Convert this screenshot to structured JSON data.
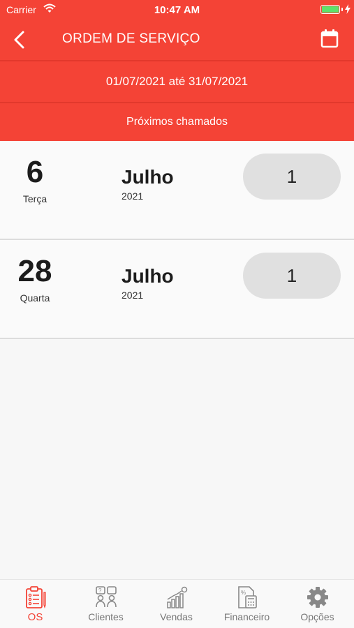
{
  "status_bar": {
    "carrier": "Carrier",
    "time": "10:47 AM"
  },
  "header": {
    "title": "ORDEM DE SERVIÇO"
  },
  "date_range": "01/07/2021 até 31/07/2021",
  "section_label": "Próximos chamados",
  "entries": [
    {
      "day": "6",
      "weekday": "Terça",
      "month": "Julho",
      "year": "2021",
      "count": "1"
    },
    {
      "day": "28",
      "weekday": "Quarta",
      "month": "Julho",
      "year": "2021",
      "count": "1"
    }
  ],
  "tabs": [
    {
      "label": "OS",
      "icon": "clipboard-checklist-icon",
      "active": true
    },
    {
      "label": "Clientes",
      "icon": "clients-icon"
    },
    {
      "label": "Vendas",
      "icon": "sales-chart-icon"
    },
    {
      "label": "Financeiro",
      "icon": "calculator-icon"
    },
    {
      "label": "Opções",
      "icon": "gear-icon"
    }
  ],
  "colors": {
    "primary": "#f44336",
    "pill": "#e0e0e0",
    "inactive": "#777777"
  }
}
